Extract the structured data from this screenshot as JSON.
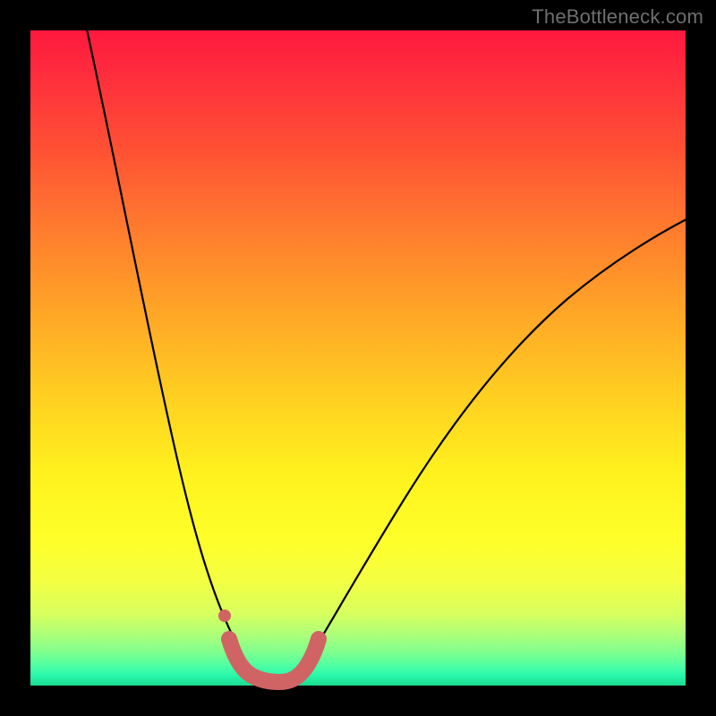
{
  "watermark": "TheBottleneck.com",
  "colors": {
    "frame": "#000000",
    "curve": "#000000",
    "marker": "#d06464",
    "gradient_top": "#ff183e",
    "gradient_bottom": "#1bd98f"
  },
  "chart_data": {
    "type": "line",
    "title": "",
    "xlabel": "",
    "ylabel": "",
    "xlim": [
      0,
      100
    ],
    "ylim": [
      0,
      100
    ],
    "grid": false,
    "legend": false,
    "note": "Axes are unlabeled in the image; values below are estimated from pixel positions and normalized to a 0–100 range on both axes. y represents bottleneck / mismatch percentage (lower is better, green region near y≈0).",
    "series": [
      {
        "name": "left-branch",
        "x": [
          8,
          10,
          12,
          14,
          16,
          18,
          20,
          22,
          24,
          26,
          28,
          30,
          32,
          33
        ],
        "y": [
          100,
          92,
          83,
          74,
          65,
          56,
          47,
          38,
          30,
          22,
          15,
          9,
          4,
          1
        ]
      },
      {
        "name": "right-branch",
        "x": [
          40,
          42,
          45,
          48,
          52,
          56,
          60,
          65,
          70,
          75,
          80,
          85,
          90,
          95,
          100
        ],
        "y": [
          1,
          4,
          9,
          15,
          22,
          29,
          35,
          42,
          48,
          53,
          58,
          62,
          66,
          69,
          72
        ]
      },
      {
        "name": "optimal-band",
        "comment": "Thick salmon-colored segment at the valley floor indicating the balanced range.",
        "x": [
          30,
          31,
          32,
          33,
          34,
          35,
          36,
          37,
          38,
          39,
          40,
          41,
          42
        ],
        "y": [
          7,
          4,
          2,
          1,
          0.5,
          0.5,
          0.5,
          0.5,
          1,
          2,
          3,
          5,
          8
        ]
      }
    ],
    "markers": [
      {
        "name": "dot-on-left-branch",
        "x": 29,
        "y": 11
      }
    ]
  }
}
